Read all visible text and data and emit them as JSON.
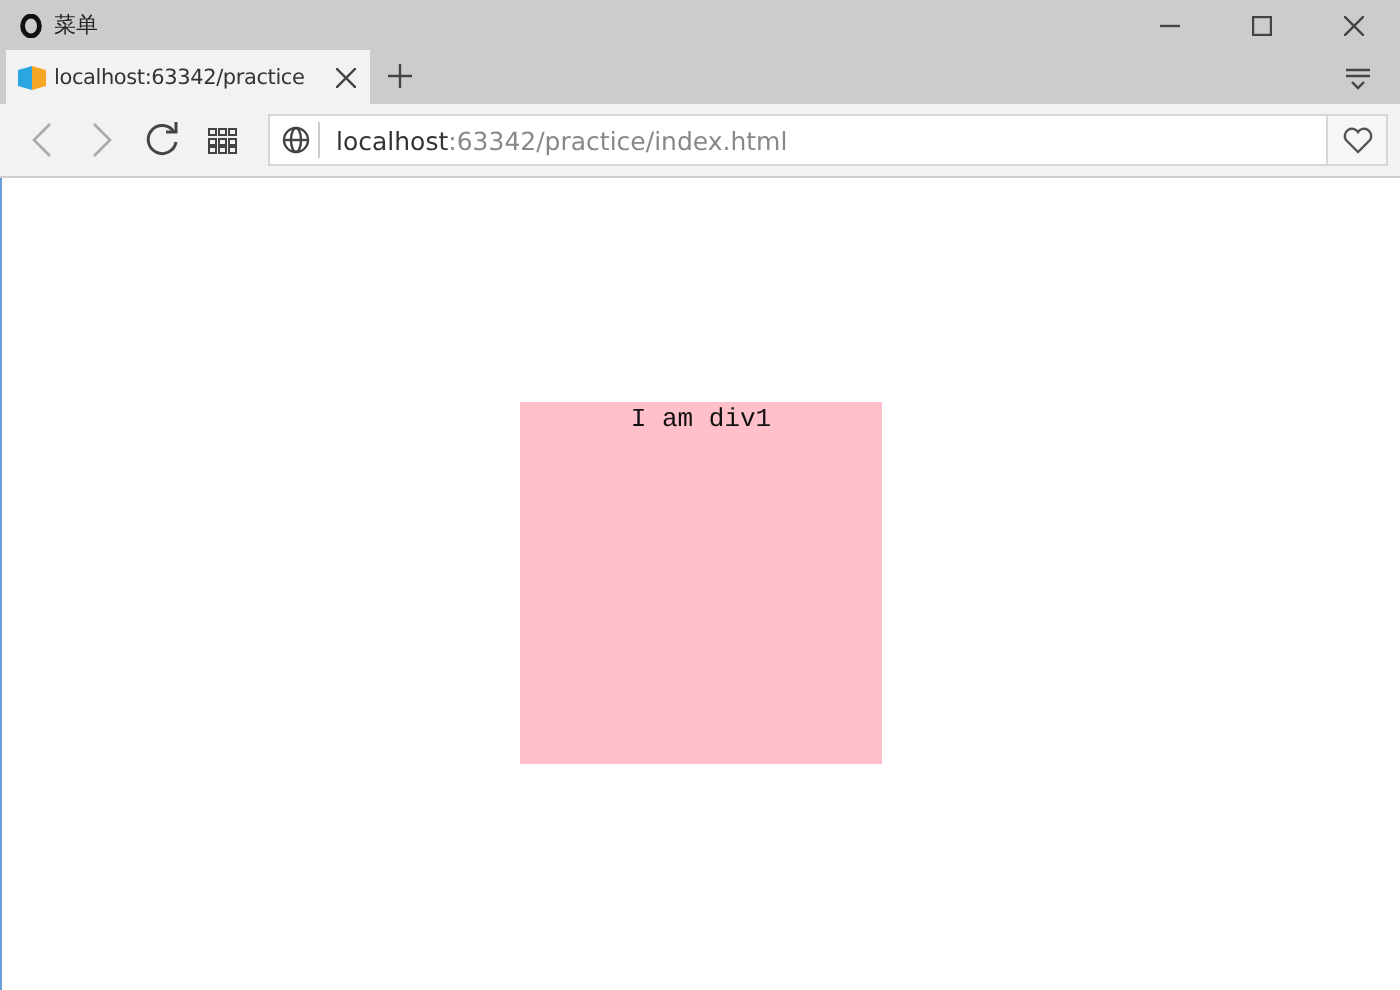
{
  "window": {
    "title": "菜单"
  },
  "tabs": [
    {
      "label": "localhost:63342/practice",
      "selected": true
    }
  ],
  "address_bar": {
    "host": "localhost",
    "path": ":63342/practice/index.html"
  },
  "page": {
    "box_text": "I am div1"
  }
}
